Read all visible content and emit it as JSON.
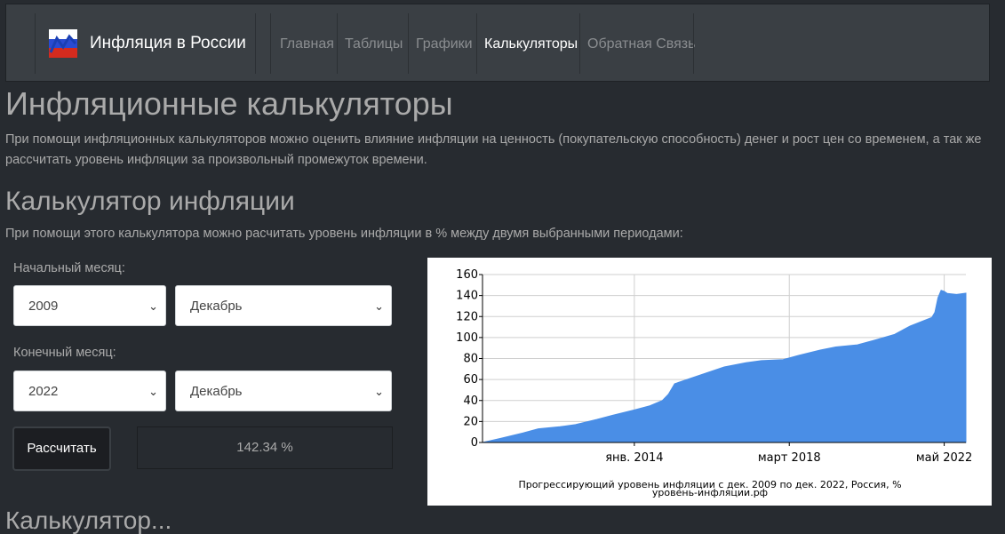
{
  "navbar": {
    "brand": "Инфляция в России",
    "items": [
      {
        "label": "Главная",
        "active": false
      },
      {
        "label": "Таблицы",
        "active": false
      },
      {
        "label": "Графики",
        "active": false
      },
      {
        "label": "Калькуляторы",
        "active": true
      },
      {
        "label": "Обратная Связь",
        "active": false
      }
    ]
  },
  "page": {
    "title": "Инфляционные калькуляторы",
    "lead": "При помощи инфляционных калькуляторов можно оценить влияние инфляции на ценность (покупательскую способность) денег и рост цен со временем, а так же рассчитать уровень инфляции за произвольный промежуток времени.",
    "next_heading": "Калькулятор..."
  },
  "calculator": {
    "heading": "Калькулятор инфляции",
    "description": "При помощи этого калькулятора можно расчитать уровень инфляции в % между двумя выбранными периодами:",
    "start_label": "Начальный месяц:",
    "start_year": "2009",
    "start_month": "Декабрь",
    "end_label": "Конечный месяц:",
    "end_year": "2022",
    "end_month": "Декабрь",
    "button_label": "Рассчитать",
    "result": "142.34 %"
  },
  "colors": {
    "background": "#272b30",
    "navbar": "#3a3f44",
    "chart_fill": "#4a8ee6"
  },
  "icons": {
    "brand_logo": "russia-chart-logo-icon",
    "select_chevron": "chevron-down-icon"
  },
  "chart_data": {
    "type": "area",
    "caption_line1": "Прогрессирующий уровень инфляции с дек. 2009 по дек. 2022, Россия, %",
    "caption_line2": "уровень-инфляции.рф",
    "ylim": [
      0,
      160
    ],
    "yticks": [
      0,
      20,
      40,
      60,
      80,
      100,
      120,
      140,
      160
    ],
    "xlim": [
      "2009-12",
      "2022-12"
    ],
    "xticks": [
      {
        "label": "янв. 2014",
        "date": "2014-01"
      },
      {
        "label": "март 2018",
        "date": "2018-03"
      },
      {
        "label": "май 2022",
        "date": "2022-05"
      }
    ],
    "grid": true,
    "x": [
      "2009-12",
      "2010-06",
      "2011-01",
      "2011-06",
      "2012-01",
      "2012-06",
      "2013-01",
      "2013-06",
      "2014-01",
      "2014-06",
      "2014-10",
      "2014-12",
      "2015-02",
      "2015-06",
      "2016-01",
      "2016-06",
      "2017-01",
      "2017-06",
      "2018-01",
      "2018-06",
      "2019-01",
      "2019-06",
      "2020-01",
      "2020-06",
      "2021-01",
      "2021-06",
      "2022-01",
      "2022-02",
      "2022-03",
      "2022-04",
      "2022-05",
      "2022-06",
      "2022-09",
      "2022-12"
    ],
    "values": [
      0,
      4,
      9,
      13,
      15,
      17,
      22,
      26,
      31,
      35,
      40,
      46,
      56,
      60,
      67,
      72,
      76,
      78,
      79,
      83,
      88,
      91,
      93,
      97,
      103,
      111,
      119,
      124,
      138,
      145,
      144,
      142,
      141,
      142.34
    ]
  }
}
